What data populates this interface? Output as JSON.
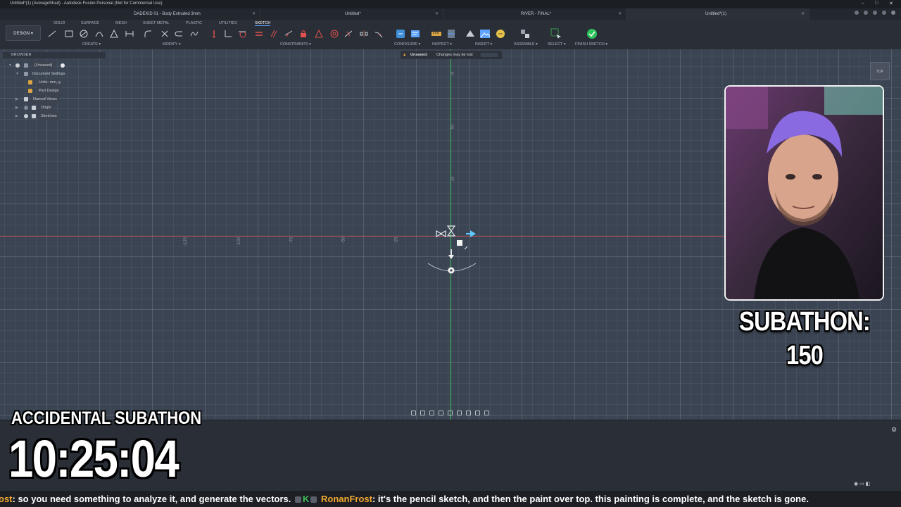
{
  "window": {
    "title": "Untitled*(1) (AverageShad) - Autodesk Fusion Personal (Not for Commercial Use)",
    "controls": [
      "–",
      "□",
      "✕"
    ]
  },
  "doc_tabs": [
    {
      "label": "DADEKID 01 - Body Extruded 3mm",
      "active": false
    },
    {
      "label": "Untitled*",
      "active": false
    },
    {
      "label": "RIVER - FINAL*",
      "active": false
    },
    {
      "label": "Untitled*(1)",
      "active": true
    }
  ],
  "toolbar": {
    "workspace": "DESIGN",
    "workspace_tabs": [
      "SOLID",
      "SURFACE",
      "MESH",
      "SHEET METAL",
      "PLASTIC",
      "UTILITIES",
      "SKETCH"
    ],
    "active_tab": "SKETCH",
    "groups": {
      "create": "CREATE",
      "modify": "MODIFY",
      "constraints": "CONSTRAINTS",
      "configure": "CONFIGURE",
      "inspect": "INSPECT",
      "insert": "INSERT",
      "assemble": "ASSEMBLE",
      "select": "SELECT",
      "finish": "FINISH SKETCH"
    }
  },
  "browser": {
    "header": "BROWSER",
    "root": "(Unsaved)",
    "items": [
      {
        "label": "Document Settings",
        "level": 1
      },
      {
        "label": "Units: mm, g",
        "level": 2
      },
      {
        "label": "Part Design",
        "level": 2
      },
      {
        "label": "Named Views",
        "level": 1
      },
      {
        "label": "Origin",
        "level": 1
      },
      {
        "label": "Sketches",
        "level": 1
      }
    ]
  },
  "banner": {
    "title": "Unsaved:",
    "message": "Changes may be lost"
  },
  "canvas": {
    "vertical_ticks": [
      "75",
      "50",
      "25"
    ],
    "horizontal_ticks": [
      "-125",
      "-100",
      "-75",
      "-50",
      "-25"
    ],
    "viewcube_label": "TOP"
  },
  "overlay": {
    "subathon_count": "SUBATHON: 150",
    "title": "ACCIDENTAL SUBATHON",
    "timer": "10:25:04"
  },
  "chat": {
    "seg1_user": "ost",
    "seg1_text": ": so you need something to analyze it, and generate the vectors.",
    "seg2_user": "RonanFrost",
    "seg2_text": ": it's the pencil sketch, and then the paint over top. this painting is complete, and the sketch is gone."
  },
  "colors": {
    "canvas_bg": "#3b4452",
    "y_axis": "#3fbf5a",
    "x_axis": "#b24b55",
    "accent": "#5ea4ff",
    "finish_green": "#2ec35a"
  }
}
